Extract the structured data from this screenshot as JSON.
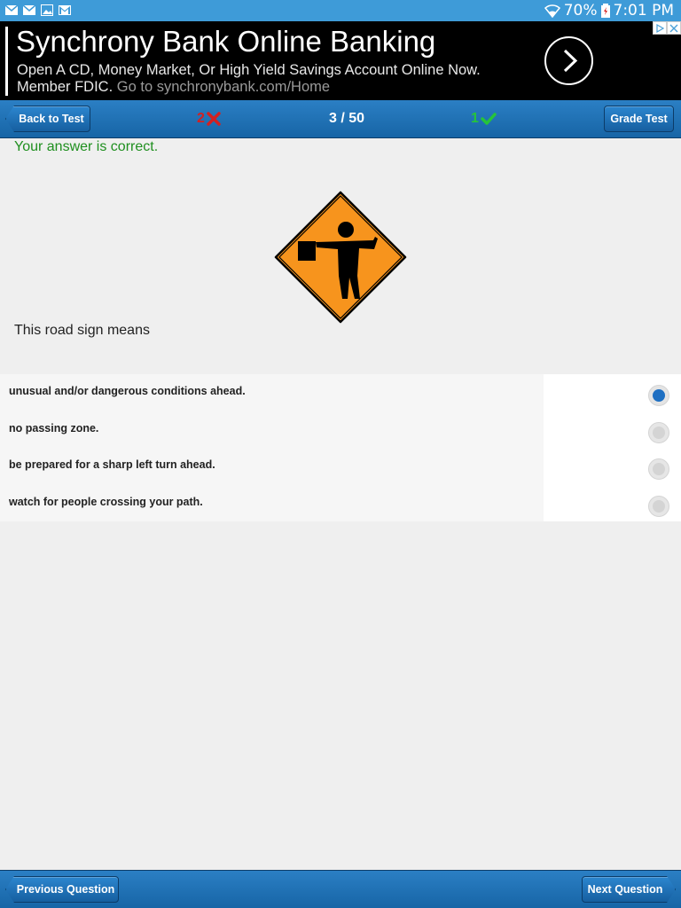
{
  "status_bar": {
    "battery": "70%",
    "time": "7:01 PM",
    "left_icons": [
      "mail-icon",
      "mail-icon",
      "image-icon",
      "gmail-icon"
    ],
    "right_icons": [
      "wifi-icon",
      "battery-icon"
    ]
  },
  "ad": {
    "title": "Synchrony Bank Online Banking",
    "line1": "Open A CD, Money Market, Or High Yield Savings Account Online Now.",
    "line2_prefix": "Member FDIC.",
    "line2_link": "Go to synchronybank.com/Home"
  },
  "navbar": {
    "back_label": "Back to Test",
    "wrong_count": "2",
    "counter": "3 / 50",
    "right_count": "1",
    "grade_label": "Grade Test"
  },
  "result_text": "Your answer is correct.",
  "question": "This road sign means",
  "sign_icon": "flagger-sign-icon",
  "answers": [
    {
      "label": "unusual and/or dangerous conditions ahead.",
      "selected": true
    },
    {
      "label": "no passing zone.",
      "selected": false
    },
    {
      "label": "be prepared for a sharp left turn ahead.",
      "selected": false
    },
    {
      "label": "watch for people crossing your path.",
      "selected": false
    }
  ],
  "bottom_bar": {
    "prev_label": "Previous Question",
    "next_label": "Next Question"
  },
  "colors": {
    "nav_blue": "#1a6bb0",
    "correct_green": "#1f8f1f",
    "wrong_red": "#d42020",
    "right_green": "#26c43a",
    "selected_blue": "#1e6fc2",
    "sign_orange": "#f7941d"
  }
}
